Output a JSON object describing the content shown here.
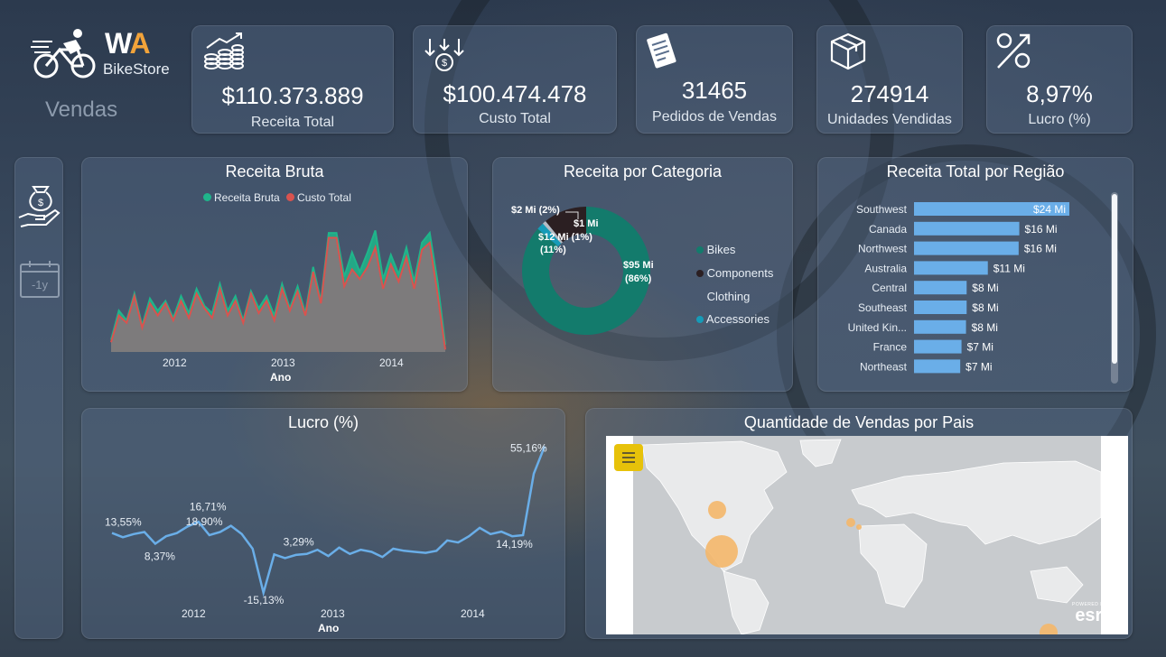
{
  "brand": {
    "wa_w": "W",
    "wa_a": "A",
    "name": "BikeStore",
    "page": "Vendas"
  },
  "colors": {
    "accent_orange": "#f2a33a",
    "receita": "#1fb58b",
    "custo": "#d9534f",
    "lucro_line": "#6aaee8",
    "bar": "#6aaee8",
    "donut_bikes": "#137b6c",
    "donut_components": "#2b1f22",
    "donut_accessories": "#169bb8"
  },
  "sidebar": {
    "money_icon": "money-hand-icon",
    "calendar_label": "-1y"
  },
  "kpis": [
    {
      "value": "$110.373.889",
      "label": "Receita Total",
      "icon": "revenue-growth-icon"
    },
    {
      "value": "$100.474.478",
      "label": "Custo Total",
      "icon": "cost-down-icon"
    },
    {
      "value": "31465",
      "label": "Pedidos de Vendas",
      "icon": "order-document-icon"
    },
    {
      "value": "274914",
      "label": "Unidades Vendidas",
      "icon": "box-icon"
    },
    {
      "value": "8,97%",
      "label": "Lucro (%)",
      "icon": "percent-icon"
    }
  ],
  "receita_bruta": {
    "title": "Receita Bruta",
    "legend": [
      "Receita Bruta",
      "Custo Total"
    ],
    "x_ticks": [
      "2012",
      "2013",
      "2014"
    ],
    "xlabel": "Ano"
  },
  "categoria": {
    "title": "Receita por Categoria",
    "labels": {
      "accessories": "$2 Mi (2%)",
      "components_a": "$1 Mi",
      "components_b": "$12 Mi (1%)",
      "components_c": "(11%)",
      "bikes_a": "$95 Mi",
      "bikes_b": "(86%)"
    },
    "legend": [
      "Bikes",
      "Components",
      "Clothing",
      "Accessories"
    ]
  },
  "regiao": {
    "title": "Receita Total por Região"
  },
  "lucro": {
    "title": "Lucro (%)",
    "x_ticks": [
      "2012",
      "2013",
      "2014"
    ],
    "xlabel": "Ano",
    "labels": [
      "13,55%",
      "8,37%",
      "18,90%",
      "16,71%",
      "-15,13%",
      "3,29%",
      "14,19%",
      "55,16%"
    ]
  },
  "mapa": {
    "title": "Quantidade de Vendas por Pais",
    "menu_icon": "hamburger-menu-icon",
    "esri_small": "POWERED BY",
    "esri": "esri"
  },
  "chart_data": [
    {
      "type": "area",
      "title": "Receita Bruta",
      "xlabel": "Ano",
      "x_ticks": [
        "2012",
        "2013",
        "2014"
      ],
      "series": [
        {
          "name": "Receita Bruta",
          "values": [
            0.5,
            1.7,
            1.3,
            2.4,
            1.1,
            2.2,
            1.7,
            2.1,
            1.4,
            2.3,
            1.6,
            2.6,
            1.9,
            1.6,
            2.8,
            1.7,
            2.3,
            1.3,
            2.5,
            1.8,
            2.3,
            1.5,
            2.8,
            1.8,
            2.7,
            1.6,
            3.5,
            2.1,
            4.9,
            4.9,
            3.1,
            4.1,
            3.3,
            4.1,
            5.0,
            3.0,
            4.0,
            3.2,
            4.3,
            2.9,
            4.5,
            4.9,
            2.9,
            0.3
          ]
        },
        {
          "name": "Custo Total",
          "values": [
            0.4,
            1.5,
            1.2,
            2.3,
            1.0,
            2.0,
            1.5,
            2.0,
            1.3,
            2.1,
            1.4,
            2.4,
            1.8,
            1.4,
            2.6,
            1.5,
            2.1,
            1.2,
            2.4,
            1.6,
            2.1,
            1.3,
            2.6,
            1.7,
            2.5,
            1.5,
            3.3,
            2.0,
            4.7,
            4.7,
            2.7,
            3.4,
            3.0,
            3.5,
            4.3,
            2.6,
            3.6,
            2.9,
            3.9,
            2.6,
            4.2,
            4.5,
            2.4,
            0.1
          ]
        }
      ]
    },
    {
      "type": "pie",
      "title": "Receita por Categoria",
      "categories": [
        "Bikes",
        "Components",
        "Clothing",
        "Accessories"
      ],
      "values": [
        95,
        12,
        1,
        2
      ],
      "units": "Mi"
    },
    {
      "type": "bar",
      "title": "Receita Total por Região",
      "categories": [
        "Southwest",
        "Canada",
        "Northwest",
        "Australia",
        "Central",
        "Southeast",
        "United Kin...",
        "France",
        "Northeast"
      ],
      "values": [
        24,
        16,
        16,
        11,
        8,
        8,
        8,
        7,
        7
      ],
      "value_labels": [
        "$24 Mi",
        "$16 Mi",
        "$16 Mi",
        "$11 Mi",
        "$8 Mi",
        "$8 Mi",
        "$8 Mi",
        "$7 Mi",
        "$7 Mi"
      ],
      "exact_values": [
        24.2,
        16.4,
        16.3,
        11.5,
        8.2,
        8.2,
        8.1,
        7.4,
        7.2
      ]
    },
    {
      "type": "line",
      "title": "Lucro (%)",
      "xlabel": "Ano",
      "x_ticks": [
        "2012",
        "2013",
        "2014"
      ],
      "series": [
        {
          "name": "Lucro (%)",
          "values": [
            13.55,
            11.5,
            13.0,
            14.0,
            8.37,
            12.0,
            13.5,
            16.71,
            18.9,
            12.5,
            14.0,
            17.0,
            13.0,
            6.0,
            -15.13,
            3.29,
            1.5,
            3.0,
            3.5,
            5.5,
            2.5,
            6.5,
            3.5,
            5.5,
            4.5,
            2.0,
            6.0,
            5.0,
            4.5,
            4.0,
            5.0,
            10.0,
            9.0,
            12.0,
            16.0,
            13.0,
            14.19,
            12.0,
            12.5,
            42.0,
            55.16
          ]
        }
      ]
    }
  ]
}
